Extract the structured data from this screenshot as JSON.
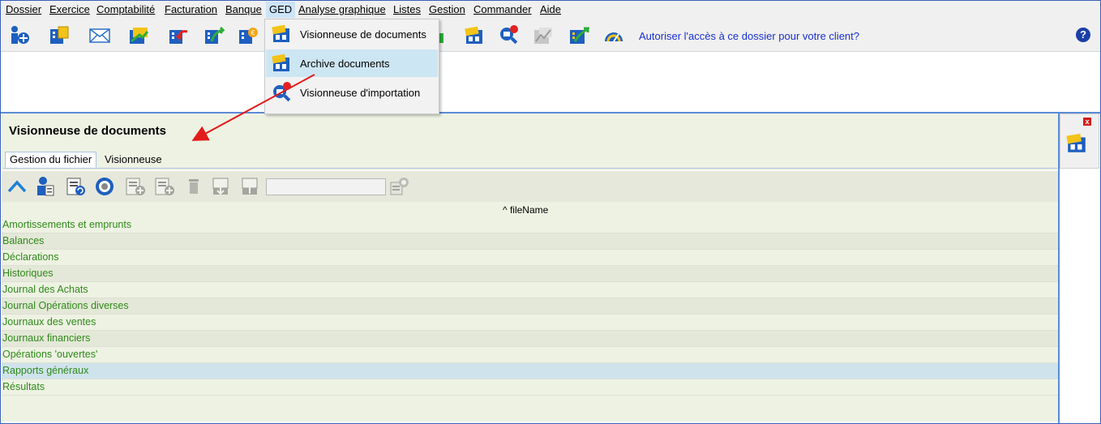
{
  "menu": [
    "Dossier",
    "Exercice",
    "Comptabilité",
    "Facturation",
    "Banque",
    "GED",
    "Analyse graphique",
    "Listes",
    "Gestion",
    "Commander",
    "Aide"
  ],
  "toolbar": {
    "promo_link": "Autoriser l'accès à ce dossier pour votre client?",
    "help": "?"
  },
  "ged_menu": {
    "items": [
      "Visionneuse de documents",
      "Archive documents",
      "Visionneuse d'importation"
    ]
  },
  "panel": {
    "title": "Visionneuse de documents",
    "tabs": [
      "Gestion du fichier",
      "Visionneuse"
    ],
    "column_header": "fileName",
    "rows": [
      "Amortissements et emprunts",
      "Balances",
      "Déclarations",
      "Historiques",
      "Journal des Achats",
      "Journal Opérations diverses",
      "Journaux des ventes",
      "Journaux financiers",
      "Opérations 'ouvertes'",
      "Rapports généraux",
      "Résultats"
    ],
    "selected_row": "Rapports généraux"
  },
  "side": {
    "close": "x"
  },
  "colors": {
    "link": "#1a2fd0",
    "row_text": "#2f8a1a",
    "accent_border": "#5b8bd6",
    "arrow": "#e31b1b"
  }
}
